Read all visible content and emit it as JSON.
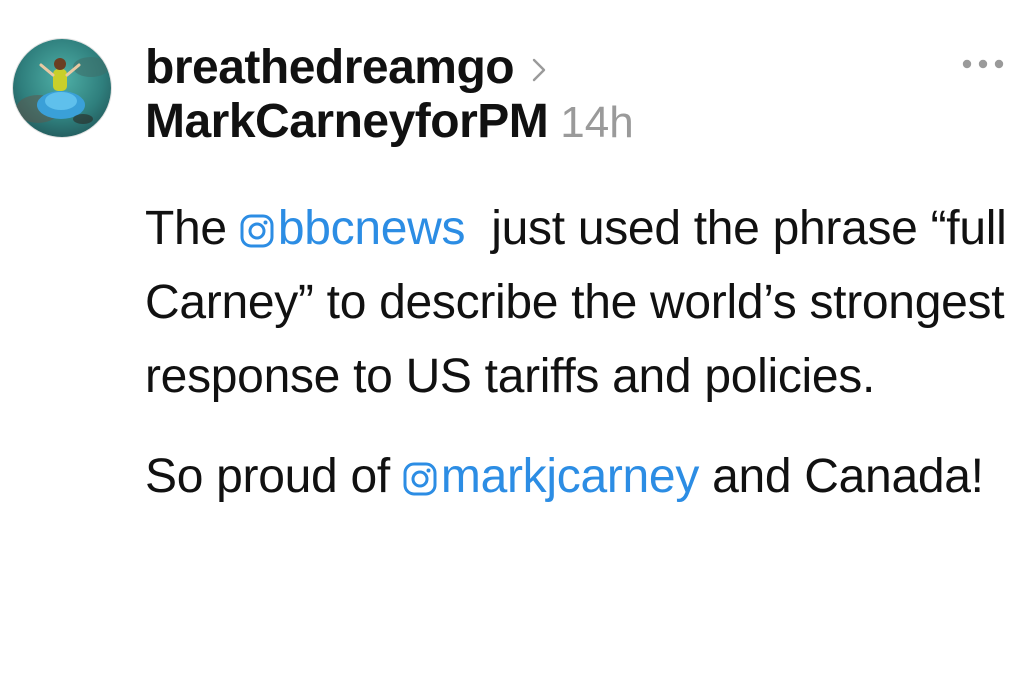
{
  "post": {
    "username": "breathedreamgo",
    "reply_to": "MarkCarneyforPM",
    "timestamp": "14h",
    "icons": {
      "username_chevron": "chevron-right-icon",
      "more_menu": "more-horizontal-icon",
      "mention": "instagram-icon"
    },
    "paragraph1": {
      "before": "The ",
      "mention": "bbcnews",
      "after": "  just used the phrase “full Carney” to describe the world’s strongest response to US tariffs and policies."
    },
    "paragraph2": {
      "before": "So proud of ",
      "mention": "markjcarney",
      "after": " and Canada!"
    },
    "colors": {
      "mention": "#2c8de4",
      "timestamp": "#9a9a9a",
      "text": "#111111"
    }
  }
}
